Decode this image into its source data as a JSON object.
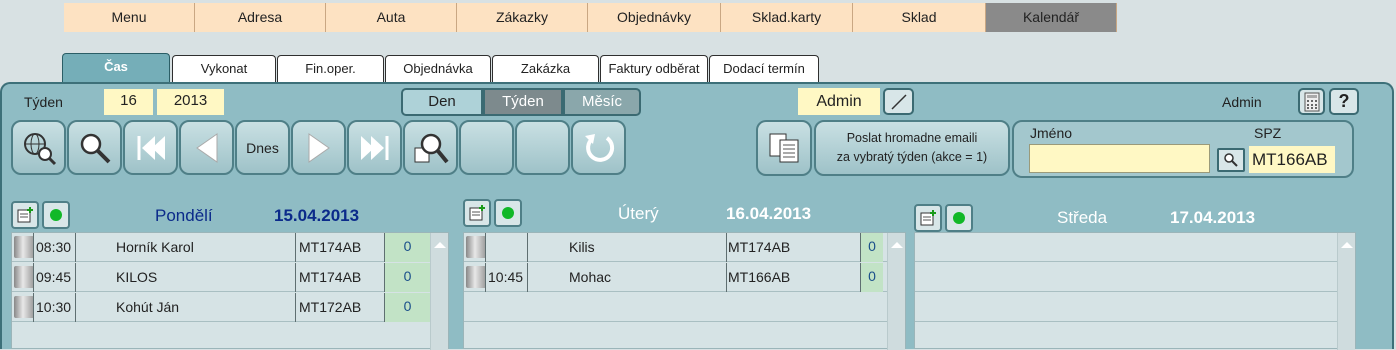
{
  "menu": {
    "items": [
      "Menu",
      "Adresa",
      "Auta",
      "Zákazky",
      "Objednávky",
      "Sklad.karty",
      "Sklad",
      "Kalendář"
    ],
    "active": "Kalendář"
  },
  "tabs": {
    "items": [
      "Čas",
      "Vykonat",
      "Fin.oper.",
      "Objednávka",
      "Zakázka",
      "Faktury odběrat",
      "Dodací termín"
    ],
    "active": "Čas"
  },
  "week": {
    "label": "Týden",
    "number": "16",
    "year": "2013"
  },
  "view_toggle": {
    "day": "Den",
    "week": "Týden",
    "month": "Měsíc",
    "selected": "Týden"
  },
  "user": {
    "box": "Admin",
    "label": "Admin"
  },
  "toolbar": {
    "today_label": "Dnes",
    "icons": [
      "globe-search-icon",
      "search-icon",
      "first-icon",
      "prev-icon",
      "",
      "next-icon",
      "last-icon",
      "search-calendar-icon",
      "",
      "",
      "refresh-icon"
    ]
  },
  "email": {
    "line1": "Poslat hromadne emaili",
    "line2": "za vybratý týden (akce = 1)"
  },
  "filter": {
    "name_label": "Jméno",
    "name_value": "",
    "spz_label": "SPZ",
    "spz_value": "MT166AB"
  },
  "days": [
    {
      "name": "Pondělí",
      "date": "15.04.2013",
      "rows": [
        {
          "time": "08:30",
          "name": "Horník Karol",
          "spz": "MT174AB",
          "count": "0"
        },
        {
          "time": "09:45",
          "name": "KILOS",
          "spz": "MT174AB",
          "count": "0"
        },
        {
          "time": "10:30",
          "name": "Kohút Ján",
          "spz": "MT172AB",
          "count": "0"
        }
      ]
    },
    {
      "name": "Úterý",
      "date": "16.04.2013",
      "rows": [
        {
          "time": "",
          "name": "Kilis",
          "spz": "MT174AB",
          "count": "0"
        },
        {
          "time": "10:45",
          "name": "Mohac",
          "spz": "MT166AB",
          "count": "0"
        }
      ]
    },
    {
      "name": "Středa",
      "date": "17.04.2013",
      "rows": []
    }
  ],
  "colors": {
    "accent": "#75aeb8",
    "menu": "#fde2c2",
    "panel": "#8fbcc4",
    "day_active": "#0b2a8a"
  }
}
